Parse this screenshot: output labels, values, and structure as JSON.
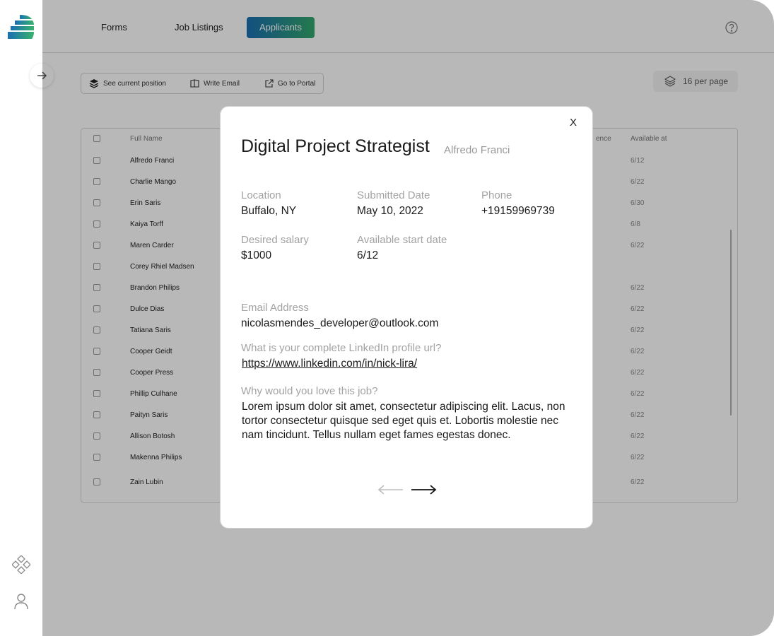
{
  "nav": {
    "tabs": [
      {
        "label": "Forms"
      },
      {
        "label": "Job Listings"
      },
      {
        "label": "Applicants"
      }
    ]
  },
  "toolbar": {
    "see_position": "See current position",
    "write_email": "Write Email",
    "go_portal": "Go to Portal"
  },
  "pagination": {
    "per_page_label": "16 per page"
  },
  "table": {
    "headers": {
      "full_name": "Full Name",
      "experience_partial": "ence",
      "available_at": "Available at"
    },
    "rows": [
      {
        "name": "Alfredo Franci",
        "available": "6/12"
      },
      {
        "name": "Charlie Mango",
        "available": "6/22"
      },
      {
        "name": "Erin Saris",
        "available": "6/30"
      },
      {
        "name": "Kaiya Torff",
        "available": "6/8"
      },
      {
        "name": "Maren Carder",
        "available": "6/22"
      },
      {
        "name": "Corey Rhiel Madsen",
        "available": ""
      },
      {
        "name": "Brandon Philips",
        "available": "6/22"
      },
      {
        "name": "Dulce Dias",
        "available": "6/22"
      },
      {
        "name": "Tatiana Saris",
        "available": "6/22"
      },
      {
        "name": "Cooper Geidt",
        "available": "6/22"
      },
      {
        "name": "Cooper Press",
        "available": "6/22"
      },
      {
        "name": "Phillip Culhane",
        "available": "6/22"
      },
      {
        "name": "Paityn Saris",
        "available": "6/22"
      },
      {
        "name": "Allison Botosh",
        "available": "6/22"
      },
      {
        "name": "Makenna Philips",
        "available": "6/22"
      },
      {
        "name": "Zain Lubin",
        "available": "6/22"
      }
    ]
  },
  "modal": {
    "close_label": "X",
    "title": "Digital Project Strategist",
    "applicant_name": "Alfredo Franci",
    "fields": {
      "location_label": "Location",
      "location_value": "Buffalo, NY",
      "submitted_label": "Submitted Date",
      "submitted_value": "May 10, 2022",
      "phone_label": "Phone",
      "phone_value": "+19159969739",
      "salary_label": "Desired salary",
      "salary_value": "$1000",
      "start_label": "Available start date",
      "start_value": "6/12",
      "email_label": "Email Address",
      "email_value": "nicolasmendes_developer@outlook.com",
      "linkedin_label": "What is your complete LinkedIn profile url?",
      "linkedin_value": "https://www.linkedin.com/in/nick-lira/",
      "why_label": "Why would you love this job?",
      "why_value": "Lorem ipsum dolor sit amet, consectetur adipiscing elit. Lacus, non tortor consectetur quisque sed eget quis et. Lobortis molestie nec nam tincidunt. Tellus nullam eget fames egestas donec."
    }
  },
  "colors": {
    "accent_start": "#1a6fb3",
    "accent_end": "#34a86b",
    "overlay": "rgba(0,0,0,0.28)"
  },
  "icons": {
    "logo": "layered-logo-icon",
    "collapse": "arrow-right-icon",
    "components": "components-icon",
    "profile": "user-icon",
    "help": "help-icon",
    "layers": "layers-icon",
    "window": "book-icon",
    "external": "external-link-icon",
    "prev": "arrow-left-icon",
    "next": "arrow-right-icon"
  }
}
